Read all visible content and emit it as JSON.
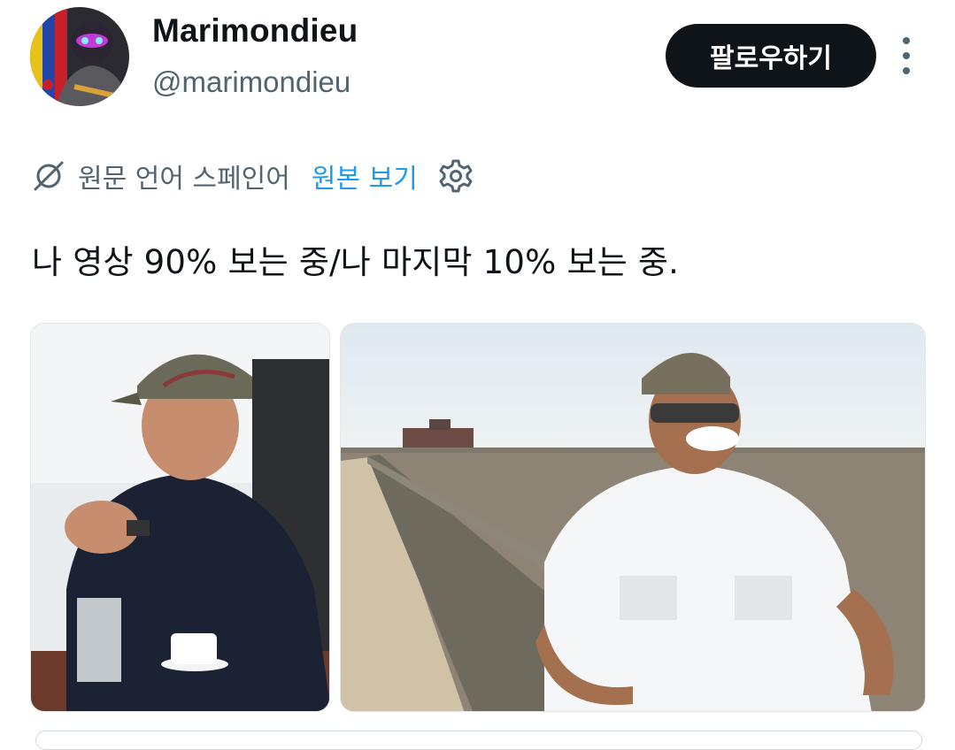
{
  "author": {
    "display_name": "Marimondieu",
    "handle": "@marimondieu",
    "avatar_icon": "avatar-image"
  },
  "actions": {
    "follow_label": "팔로우하기",
    "more_icon": "more-vertical-icon"
  },
  "translation": {
    "source_language_text": "원문 언어 스페인어",
    "show_original_label": "원본 보기",
    "icons": [
      "translate-off-icon",
      "settings-gear-icon"
    ]
  },
  "tweet": {
    "text": "나 영상 90% 보는 중/나 마지막 10% 보는 중."
  },
  "media": [
    {
      "kind": "photo",
      "description_icon": "photo-man-in-cap-at-desk"
    },
    {
      "kind": "photo",
      "description_icon": "photo-man-in-sunglasses-at-pier"
    }
  ],
  "colors": {
    "text_primary": "#0f1419",
    "text_secondary": "#536471",
    "link_blue": "#1d9bf0",
    "button_black": "#0f1419"
  }
}
